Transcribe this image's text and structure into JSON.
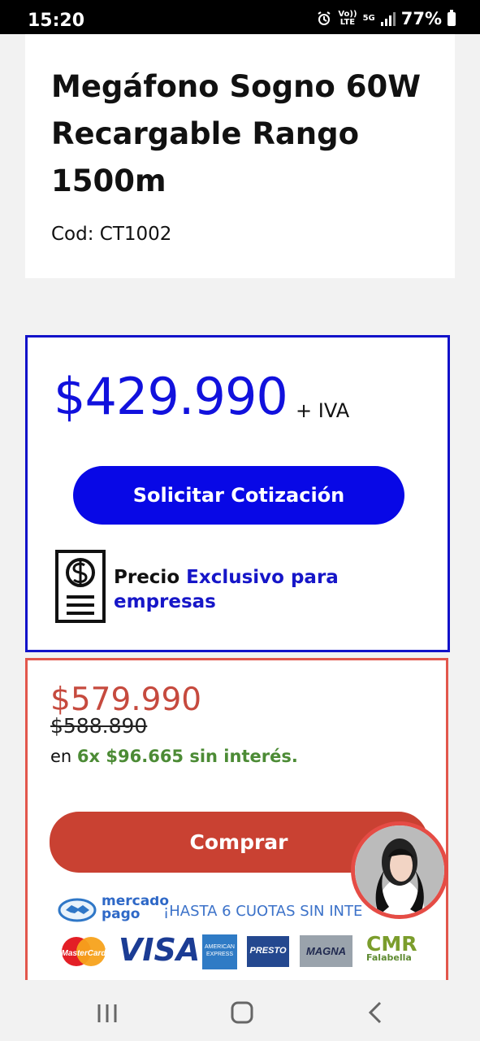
{
  "status_bar": {
    "time": "15:20",
    "network_small_1": "Vo))",
    "network_small_2": "LTE",
    "network_5g": "5G",
    "battery": "77%"
  },
  "product": {
    "title": "Megáfono Sogno 60W Recargable Rango 1500m",
    "code": "Cod: CT1002"
  },
  "business_price": {
    "price": "$429.990",
    "tax": "+ IVA",
    "button_label": "Solicitar Cotización",
    "exclusive_prefix": "Precio",
    "exclusive_highlight": "Exclusivo para empresas"
  },
  "sale": {
    "price": "$579.990",
    "old_price": "$588.890",
    "installments_prefix": "en",
    "installments_value": "6x $96.665 sin interés.",
    "buy_label": "Comprar"
  },
  "payments": {
    "mercado_pago_line1": "mercado",
    "mercado_pago_line2": "pago",
    "mercado_promo": "¡HASTA 6 CUOTAS SIN INTE",
    "mastercard": "MasterCard",
    "visa": "VISA",
    "amex": "AMERICAN EXPRESS",
    "presto": "PRESTO",
    "magna": "MAGNA",
    "cmr": "CMR",
    "falabella": "Falabella"
  },
  "colors": {
    "business_blue": "#0808e6",
    "sale_red": "#c94132",
    "installment_green": "#4c8b35"
  },
  "icons": {
    "receipt": "dollar-receipt-icon",
    "avatar": "chat-avatar",
    "recent_apps": "recent-apps-icon",
    "home": "home-icon",
    "back": "back-icon"
  }
}
